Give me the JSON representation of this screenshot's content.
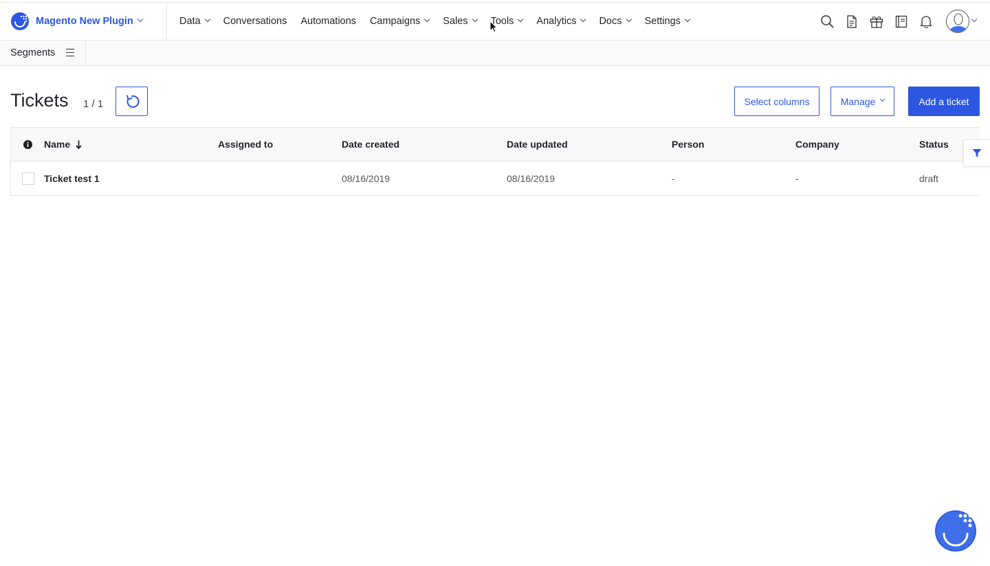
{
  "brand": {
    "name": "Magento New Plugin",
    "color": "#2d57e0"
  },
  "nav": {
    "items": [
      {
        "label": "Data",
        "has_menu": true
      },
      {
        "label": "Conversations",
        "has_menu": false
      },
      {
        "label": "Automations",
        "has_menu": false
      },
      {
        "label": "Campaigns",
        "has_menu": true
      },
      {
        "label": "Sales",
        "has_menu": true
      },
      {
        "label": "Tools",
        "has_menu": true
      },
      {
        "label": "Analytics",
        "has_menu": true
      },
      {
        "label": "Docs",
        "has_menu": true
      },
      {
        "label": "Settings",
        "has_menu": true
      }
    ]
  },
  "top_icons": [
    "search-icon",
    "document-icon",
    "gift-icon",
    "book-icon",
    "bell-icon"
  ],
  "subbar": {
    "segments_label": "Segments"
  },
  "page": {
    "title": "Tickets",
    "count": "1 / 1"
  },
  "toolbar": {
    "select_columns_label": "Select columns",
    "manage_label": "Manage",
    "add_ticket_label": "Add a ticket"
  },
  "table": {
    "columns": [
      "Name",
      "Assigned to",
      "Date created",
      "Date updated",
      "Person",
      "Company",
      "Status"
    ],
    "rows": [
      {
        "name": "Ticket test 1",
        "assigned_to": "",
        "date_created": "08/16/2019",
        "date_updated": "08/16/2019",
        "person": "-",
        "company": "-",
        "status": "draft"
      }
    ]
  },
  "colors": {
    "accent": "#2d57e0",
    "chat_widget": "#3f6fe8"
  }
}
